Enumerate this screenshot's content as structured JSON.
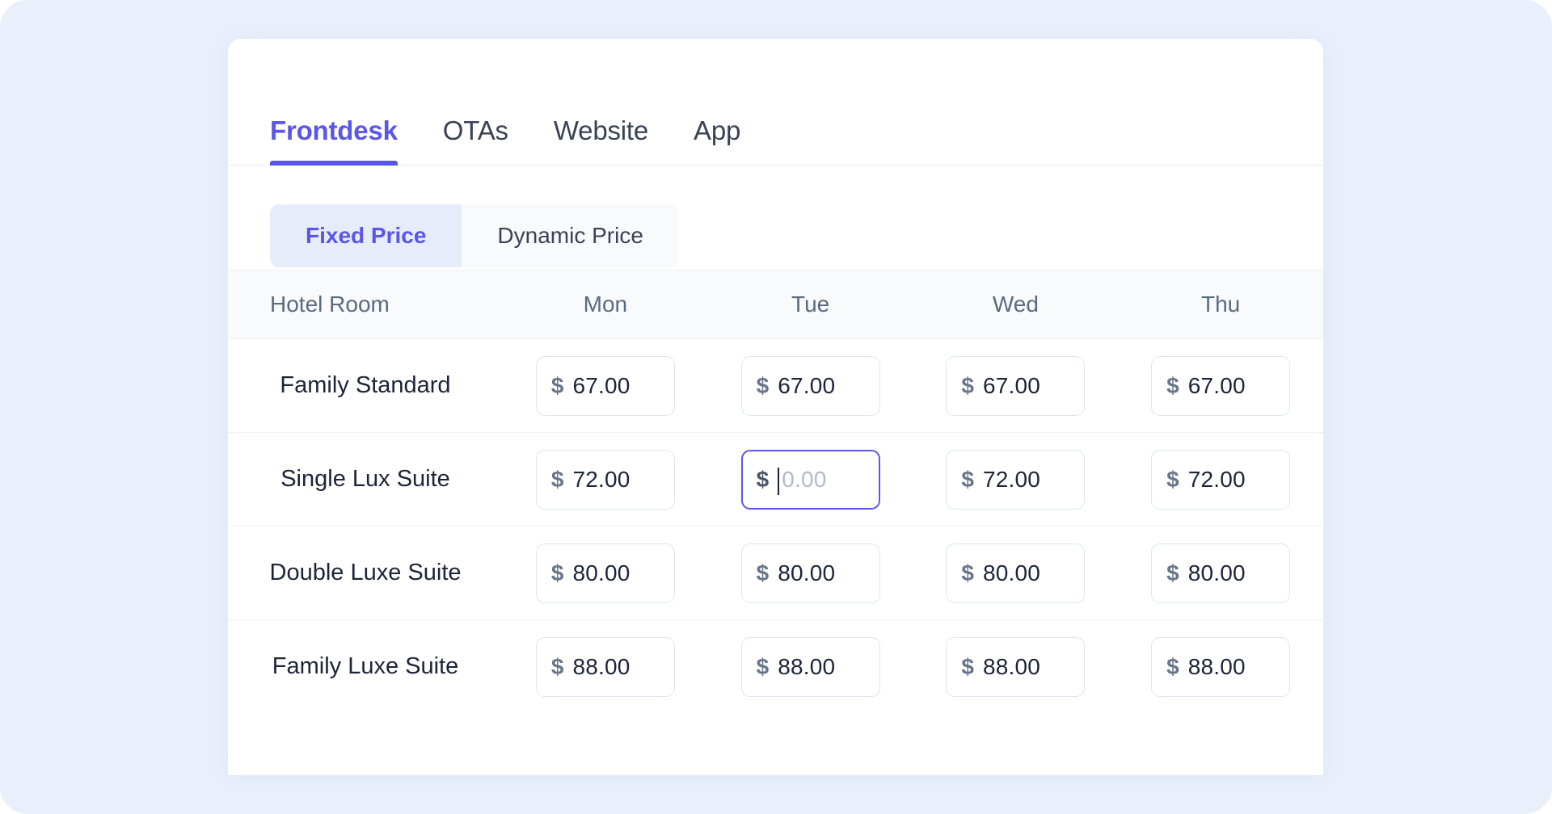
{
  "theme": {
    "accent": "#5a56e9",
    "backdrop": "#e9f0fb",
    "card_bg": "#ffffff",
    "text_dark": "#1c2438",
    "text_muted": "#5b6a80",
    "border": "#dfe5ee",
    "segment_active_bg": "#e7ecfa",
    "segment_bg": "#f9fafc",
    "table_header_bg": "#f8fafc",
    "placeholder": "#b3bac6"
  },
  "tabs": [
    {
      "label": "Frontdesk",
      "active": true
    },
    {
      "label": "OTAs",
      "active": false
    },
    {
      "label": "Website",
      "active": false
    },
    {
      "label": "App",
      "active": false
    }
  ],
  "price_mode": {
    "options": [
      {
        "label": "Fixed Price",
        "active": true
      },
      {
        "label": "Dynamic Price",
        "active": false
      }
    ]
  },
  "table": {
    "columns": [
      "Hotel Room",
      "Mon",
      "Tue",
      "Wed",
      "Thu"
    ],
    "currency_symbol": "$",
    "placeholder": "0.00",
    "rows": [
      {
        "room": "Family Standard",
        "prices": [
          {
            "value": "67.00",
            "focused": false
          },
          {
            "value": "67.00",
            "focused": false
          },
          {
            "value": "67.00",
            "focused": false
          },
          {
            "value": "67.00",
            "focused": false
          }
        ]
      },
      {
        "room": "Single Lux Suite",
        "prices": [
          {
            "value": "72.00",
            "focused": false
          },
          {
            "value": "",
            "focused": true
          },
          {
            "value": "72.00",
            "focused": false
          },
          {
            "value": "72.00",
            "focused": false
          }
        ]
      },
      {
        "room": "Double Luxe Suite",
        "prices": [
          {
            "value": "80.00",
            "focused": false
          },
          {
            "value": "80.00",
            "focused": false
          },
          {
            "value": "80.00",
            "focused": false
          },
          {
            "value": "80.00",
            "focused": false
          }
        ]
      },
      {
        "room": "Family Luxe Suite",
        "prices": [
          {
            "value": "88.00",
            "focused": false
          },
          {
            "value": "88.00",
            "focused": false
          },
          {
            "value": "88.00",
            "focused": false
          },
          {
            "value": "88.00",
            "focused": false
          }
        ]
      }
    ]
  }
}
